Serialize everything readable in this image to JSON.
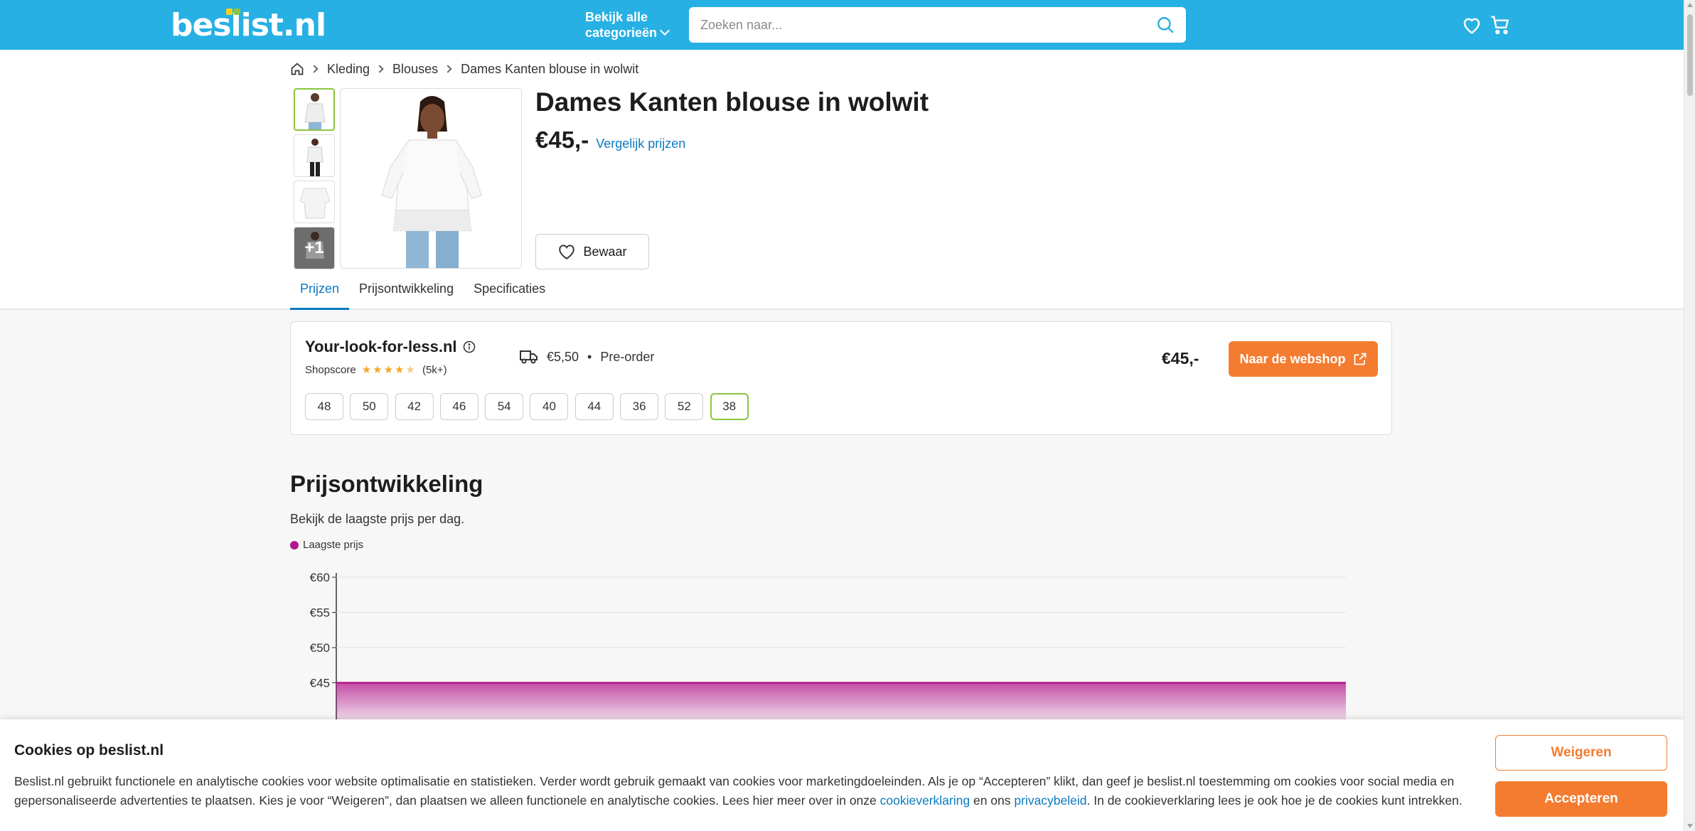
{
  "header": {
    "logo_main": "beslist",
    "logo_tld": ".nl",
    "categories_line1": "Bekijk alle",
    "categories_line2": "categorieën",
    "search_placeholder": "Zoeken naar...",
    "brand_color": "#27b0e3"
  },
  "breadcrumb": [
    "Kleding",
    "Blouses",
    "Dames Kanten blouse in wolwit"
  ],
  "product": {
    "title": "Dames Kanten blouse in wolwit",
    "price": "€45,-",
    "compare_link": "Vergelijk prijzen",
    "save_label": "Bewaar",
    "more_images": "+1"
  },
  "tabs": [
    {
      "label": "Prijzen",
      "active": true
    },
    {
      "label": "Prijsontwikkeling",
      "active": false
    },
    {
      "label": "Specificaties",
      "active": false
    }
  ],
  "offer": {
    "shop": "Your-look-for-less.nl",
    "shopscore_label": "Shopscore",
    "rating": 4.5,
    "reviews": "(5k+)",
    "shipping": "€5,50",
    "bullet": "•",
    "availability": "Pre-order",
    "price": "€45,-",
    "button": "Naar de webshop",
    "sizes": [
      "48",
      "50",
      "42",
      "46",
      "54",
      "40",
      "44",
      "36",
      "52",
      "38"
    ],
    "selected_size": "38"
  },
  "price_history": {
    "title": "Prijsontwikkeling",
    "subtitle": "Bekijk de laagste prijs per dag.",
    "legend": "Laagste prijs"
  },
  "chart_data": {
    "type": "area",
    "y_ticks": [
      "€60",
      "€55",
      "€50",
      "€45"
    ],
    "ylim": [
      40,
      60
    ],
    "series": [
      {
        "name": "Laagste prijs",
        "values": [
          45,
          45
        ]
      }
    ],
    "color": "#b4168c"
  },
  "cookie": {
    "title": "Cookies op beslist.nl",
    "text_1": "Beslist.nl gebruikt functionele en analytische cookies voor website optimalisatie en statistieken. Verder wordt gebruik gemaakt van cookies voor marketingdoeleinden. Als je op “Accepteren” klikt, dan geef je beslist.nl toestemming om cookies voor social media en gepersonaliseerde advertenties te plaatsen. Kies je voor “Weigeren”, dan plaatsen we alleen functionele en analytische cookies. Lees hier meer over in onze ",
    "link_1": "cookieverklaring",
    "text_2": " en ons ",
    "link_2": "privacybeleid",
    "text_3": ". In de cookieverklaring lees je ook hoe je de cookies kunt intrekken.",
    "decline": "Weigeren",
    "accept": "Accepteren",
    "accent_color": "#f47c30"
  }
}
